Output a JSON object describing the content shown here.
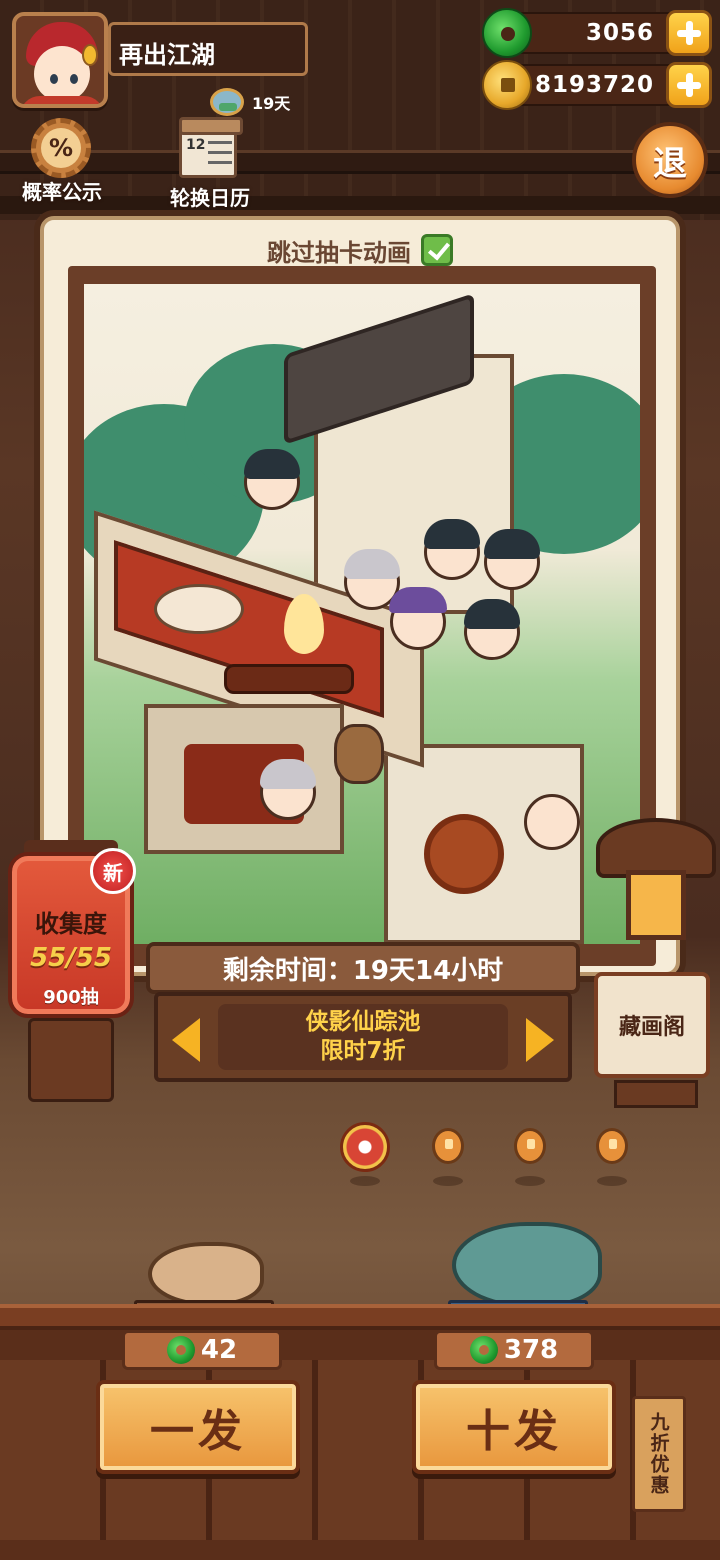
{
  "player": {
    "name": "再出江湖",
    "days": "19天"
  },
  "currency": {
    "jade": "3056",
    "gold": "8193720"
  },
  "features": {
    "probability": "概率公示",
    "calendar": "轮换日历",
    "calendar_icon_text": "12",
    "back": "退"
  },
  "panel": {
    "skip_animation": "跳过抽卡动画",
    "skip_checked": true
  },
  "collection": {
    "badge": "新",
    "title": "收集度",
    "progress": "55/55",
    "draws": "900抽"
  },
  "banner": {
    "time_remaining": "剩余时间：19天14小时",
    "pool_name": "侠影仙踪池",
    "pool_discount": "限时7折"
  },
  "gallery": {
    "label": "藏画阁"
  },
  "pager": {
    "count": 4,
    "active_index": 0
  },
  "draw": {
    "single": {
      "label": "一发",
      "cost": "42"
    },
    "ten": {
      "label": "十发",
      "cost": "378"
    },
    "discount_tag": "九折优惠"
  },
  "colors": {
    "accent_gold": "#ffd24a",
    "button_orange": "#e8963c",
    "jade_green": "#1f9a2e"
  },
  "icons": [
    "jade-coin-icon",
    "gold-coin-icon",
    "plus-icon",
    "percent-gear-icon",
    "calendar-icon",
    "hourglass-icon",
    "checkbox-checked-icon",
    "arrow-left-icon",
    "arrow-right-icon"
  ]
}
